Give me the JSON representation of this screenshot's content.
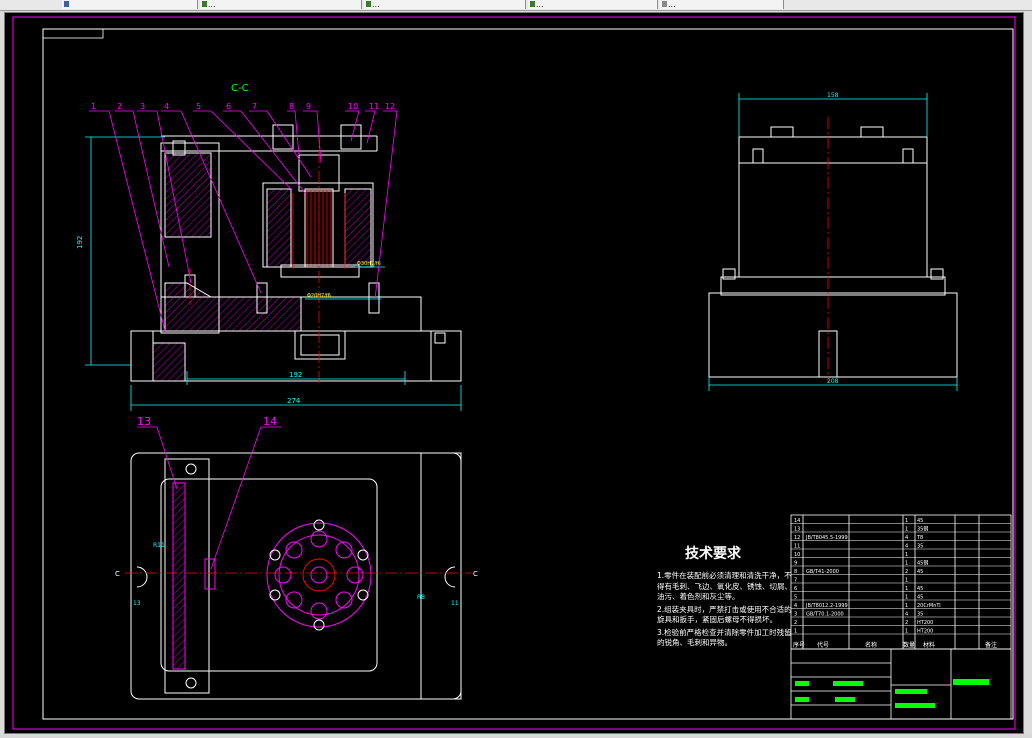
{
  "tabs": [
    {
      "label": ""
    },
    {
      "label": "..."
    },
    {
      "label": "..."
    },
    {
      "label": "..."
    },
    {
      "label": "..."
    }
  ],
  "colors": {
    "background": "#000000",
    "frame": "#ff00ff",
    "geometry": "#ffffff",
    "dimension": "#00ffff",
    "leader": "#ff00ff",
    "hidden": "#ff0000",
    "text_label": "#00ff00"
  },
  "drawing": {
    "section_label": "C-C",
    "part_numbers": [
      "1",
      "2",
      "3",
      "4",
      "5",
      "6",
      "7",
      "8",
      "9",
      "10",
      "11",
      "12"
    ],
    "callouts": [
      "13",
      "14"
    ],
    "dims": {
      "height": "192",
      "width_inner": "192",
      "width_total": "274",
      "top_width": "158",
      "side_width": "208",
      "fit_1": "Φ30H7/f6",
      "fit_2": "Φ20H7/f6",
      "r_left": "R11",
      "r_right": "R8",
      "small_left": "13",
      "small_right": "11",
      "cut_left": "C",
      "cut_right": "C"
    }
  },
  "notes": {
    "title": "技术要求",
    "items": [
      "1.零件在装配前必须清理和清洗干净，不得有毛刺、飞边、氧化皮、锈蚀、切屑、油污、着色剂和灰尘等。",
      "2.组装夹具时，严禁打击或使用不合适的旋具和扳手，紧固后螺母不得损坏。",
      "3.检验前严格检查并清除零件加工时残留的锐角、毛刺和异物。"
    ]
  },
  "bom": {
    "rows": [
      [
        "14",
        "",
        "",
        "1",
        "45"
      ],
      [
        "13",
        "",
        "",
        "1",
        "35钢"
      ],
      [
        "12",
        "JB/T8045.5-1999",
        "",
        "4",
        "T8"
      ],
      [
        "11",
        "",
        "",
        "4",
        "35"
      ],
      [
        "10",
        "",
        "",
        "1",
        ""
      ],
      [
        "9",
        "",
        "",
        "1",
        "45钢"
      ],
      [
        "8",
        "GB/T41-2000",
        "",
        "2",
        "45"
      ],
      [
        "7",
        "",
        "",
        "1",
        ""
      ],
      [
        "6",
        "",
        "",
        "1",
        "45"
      ],
      [
        "5",
        "",
        "",
        "1",
        "45"
      ],
      [
        "4",
        "JB/T8012.2-1999",
        "",
        "1",
        "20CrMnTi"
      ],
      [
        "3",
        "GB/T70.1-2000",
        "",
        "4",
        "35"
      ],
      [
        "2",
        "",
        "",
        "2",
        "HT200"
      ],
      [
        "1",
        "",
        "",
        "1",
        "HT200"
      ]
    ],
    "header": [
      "序号",
      "代号",
      "名称",
      "数量",
      "材料",
      "",
      "备注"
    ]
  },
  "title_block": {
    "drawing_name": "",
    "company": ""
  }
}
